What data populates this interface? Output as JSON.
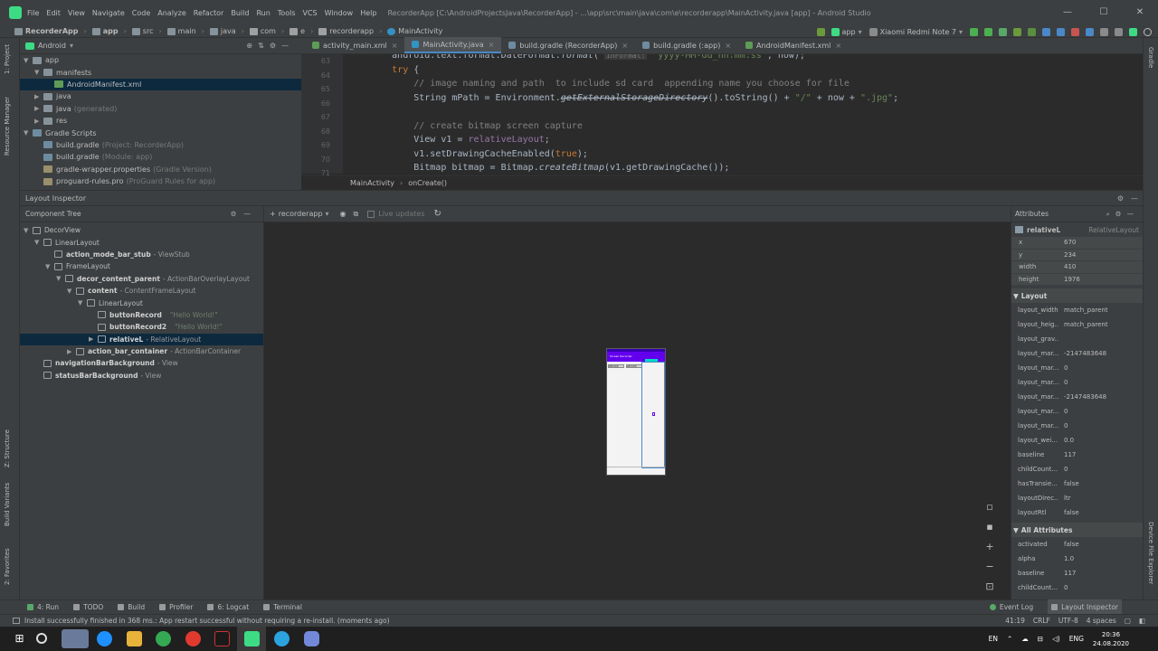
{
  "menu": {
    "items": [
      "File",
      "Edit",
      "View",
      "Navigate",
      "Code",
      "Analyze",
      "Refactor",
      "Build",
      "Run",
      "Tools",
      "VCS",
      "Window",
      "Help"
    ],
    "window_title": "RecorderApp [C:\\AndroidProjectsJava\\RecorderApp] - ...\\app\\src\\main\\java\\com\\e\\recorderapp\\MainActivity.java [app] - Android Studio",
    "window_controls": [
      "—",
      "☐",
      "✕"
    ]
  },
  "navbar": {
    "crumbs": [
      "RecorderApp",
      "app",
      "src",
      "main",
      "java",
      "com",
      "e",
      "recorderapp",
      "MainActivity"
    ],
    "run_config": "app",
    "device": "Xiaomi Redmi Note 7"
  },
  "left_strip": {
    "tabs": [
      "1: Project",
      "Resource Manager",
      "Z: Structure",
      "Build Variants",
      "2: Favorites"
    ]
  },
  "right_strip": {
    "tabs": [
      "Gradle",
      "Device File Explorer"
    ]
  },
  "project": {
    "view_label": "Android",
    "items": [
      {
        "label": "app",
        "hint": "",
        "depth": 0,
        "expanded": true,
        "icon": "folder"
      },
      {
        "label": "manifests",
        "hint": "",
        "depth": 1,
        "expanded": true,
        "icon": "folder"
      },
      {
        "label": "AndroidManifest.xml",
        "hint": "",
        "depth": 2,
        "expanded": null,
        "icon": "xml",
        "selected": true
      },
      {
        "label": "java",
        "hint": "",
        "depth": 1,
        "expanded": false,
        "icon": "folder"
      },
      {
        "label": "java",
        "hint": "(generated)",
        "depth": 1,
        "expanded": false,
        "icon": "folder"
      },
      {
        "label": "res",
        "hint": "",
        "depth": 1,
        "expanded": false,
        "icon": "folder"
      },
      {
        "label": "Gradle Scripts",
        "hint": "",
        "depth": 0,
        "expanded": true,
        "icon": "gradle"
      },
      {
        "label": "build.gradle",
        "hint": "(Project: RecorderApp)",
        "depth": 1,
        "expanded": null,
        "icon": "gradle"
      },
      {
        "label": "build.gradle",
        "hint": "(Module: app)",
        "depth": 1,
        "expanded": null,
        "icon": "gradle"
      },
      {
        "label": "gradle-wrapper.properties",
        "hint": "(Gradle Version)",
        "depth": 1,
        "expanded": null,
        "icon": "props"
      },
      {
        "label": "proguard-rules.pro",
        "hint": "(ProGuard Rules for app)",
        "depth": 1,
        "expanded": null,
        "icon": "props"
      }
    ]
  },
  "editor": {
    "tabs": [
      {
        "label": "activity_main.xml",
        "active": false,
        "color": "#5e9c56"
      },
      {
        "label": "MainActivity.java",
        "active": true,
        "color": "#3592c4"
      },
      {
        "label": "build.gradle (RecorderApp)",
        "active": false,
        "color": "#6d8ca0"
      },
      {
        "label": "build.gradle (:app)",
        "active": false,
        "color": "#6d8ca0"
      },
      {
        "label": "AndroidManifest.xml",
        "active": false,
        "color": "#5e9c56"
      }
    ],
    "line_numbers": [
      "63",
      "64",
      "65",
      "66",
      "67",
      "68",
      "69",
      "70",
      "71"
    ],
    "breadcrumb": [
      "MainActivity",
      "onCreate()"
    ]
  },
  "layout_inspector": {
    "title": "Layout Inspector",
    "component_tree_title": "Component Tree",
    "process": "recorderapp",
    "live_updates": "Live updates",
    "tree": [
      {
        "name": "DecorView",
        "type": "",
        "extra": "",
        "depth": 0,
        "arrow": "▼",
        "bold": false
      },
      {
        "name": "LinearLayout",
        "type": "",
        "extra": "",
        "depth": 1,
        "arrow": "▼",
        "bold": false
      },
      {
        "name": "action_mode_bar_stub",
        "type": "- ViewStub",
        "extra": "",
        "depth": 2,
        "arrow": "",
        "bold": true
      },
      {
        "name": "FrameLayout",
        "type": "",
        "extra": "",
        "depth": 2,
        "arrow": "▼",
        "bold": false
      },
      {
        "name": "decor_content_parent",
        "type": "- ActionBarOverlayLayout",
        "extra": "",
        "depth": 3,
        "arrow": "▼",
        "bold": true
      },
      {
        "name": "content",
        "type": "- ContentFrameLayout",
        "extra": "",
        "depth": 4,
        "arrow": "▼",
        "bold": true
      },
      {
        "name": "LinearLayout",
        "type": "",
        "extra": "",
        "depth": 5,
        "arrow": "▼",
        "bold": false
      },
      {
        "name": "buttonRecord",
        "type": "",
        "extra": "\"Hello World!\"",
        "depth": 6,
        "arrow": "",
        "bold": true
      },
      {
        "name": "buttonRecord2",
        "type": "",
        "extra": "\"Hello World!\"",
        "depth": 6,
        "arrow": "",
        "bold": true
      },
      {
        "name": "relativeL",
        "type": "- RelativeLayout",
        "extra": "",
        "depth": 6,
        "arrow": "▶",
        "bold": true,
        "selected": true
      },
      {
        "name": "action_bar_container",
        "type": "- ActionBarContainer",
        "extra": "",
        "depth": 4,
        "arrow": "▶",
        "bold": true
      },
      {
        "name": "navigationBarBackground",
        "type": "- View",
        "extra": "",
        "depth": 1,
        "arrow": "",
        "bold": true
      },
      {
        "name": "statusBarBackground",
        "type": "- View",
        "extra": "",
        "depth": 1,
        "arrow": "",
        "bold": true
      }
    ],
    "preview": {
      "action_bar_text": "Screen Recorder",
      "button1": "RECORD",
      "button2": "RECORD"
    }
  },
  "attributes": {
    "title": "Attributes",
    "selected_name": "relativeL",
    "selected_type": "RelativeLayout",
    "box": [
      {
        "k": "x",
        "v": "670"
      },
      {
        "k": "y",
        "v": "234"
      },
      {
        "k": "width",
        "v": "410"
      },
      {
        "k": "height",
        "v": "1976"
      }
    ],
    "layout_section": "Layout",
    "layout": [
      {
        "k": "layout_width",
        "v": "match_parent"
      },
      {
        "k": "layout_heig...",
        "v": "match_parent"
      },
      {
        "k": "layout_grav...",
        "v": ""
      },
      {
        "k": "layout_mar...",
        "v": "-2147483648"
      },
      {
        "k": "layout_mar...",
        "v": "0"
      },
      {
        "k": "layout_mar...",
        "v": "0"
      },
      {
        "k": "layout_mar...",
        "v": "-2147483648"
      },
      {
        "k": "layout_mar...",
        "v": "0"
      },
      {
        "k": "layout_mar...",
        "v": "0"
      },
      {
        "k": "layout_wei...",
        "v": "0.0"
      },
      {
        "k": "baseline",
        "v": "117"
      },
      {
        "k": "childCount...",
        "v": "0"
      },
      {
        "k": "hasTransie...",
        "v": "false"
      },
      {
        "k": "layoutDirec...",
        "v": "ltr"
      },
      {
        "k": "layoutRtl",
        "v": "false"
      }
    ],
    "all_section": "All Attributes",
    "all": [
      {
        "k": "activated",
        "v": "false"
      },
      {
        "k": "alpha",
        "v": "1.0"
      },
      {
        "k": "baseline",
        "v": "117"
      },
      {
        "k": "childCount...",
        "v": "0"
      }
    ]
  },
  "bottom_tools": {
    "left": [
      "4: Run",
      "TODO",
      "Build",
      "Profiler",
      "6: Logcat",
      "Terminal"
    ],
    "right": [
      "Event Log",
      "Layout Inspector"
    ]
  },
  "status": {
    "message": "Install successfully finished in 368 ms.: App restart successful without requiring a re-install. (moments ago)",
    "position": "41:19",
    "line_sep": "CRLF",
    "encoding": "UTF-8",
    "indent": "4 spaces"
  },
  "taskbar": {
    "lang": "ENG",
    "input_lang": "EN",
    "time": "20:36",
    "date": "24.08.2020"
  },
  "colors": {
    "accent": "#4a88c7",
    "preview_action_bar": "#6200ee",
    "android_green": "#3ddc84"
  }
}
